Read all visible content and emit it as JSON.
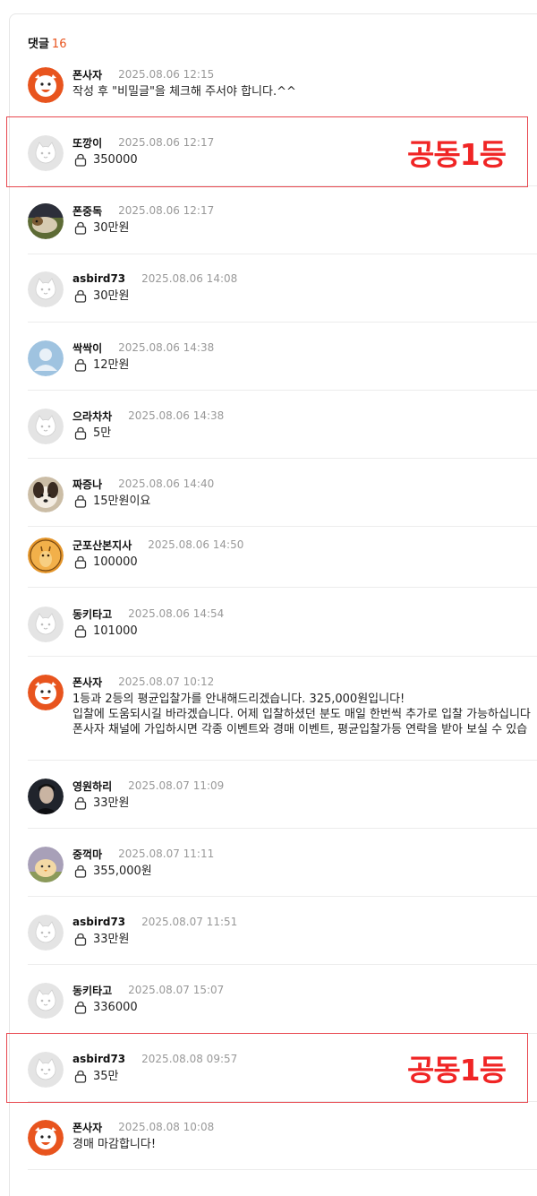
{
  "header": {
    "label": "댓글",
    "count": "16"
  },
  "badge_text": "공동1등",
  "colors": {
    "accent": "#e8541e",
    "badge": "#f02525",
    "highlight_border": "#e8474f"
  },
  "comments": [
    {
      "author": "폰사자",
      "date": "2025.08.06 12:15",
      "avatar": "lion",
      "secret": false,
      "lines": [
        "작성 후 \"비밀글\"을  체크해 주서야 합니다.^^"
      ]
    },
    {
      "author": "또깡이",
      "date": "2025.08.06 12:17",
      "avatar": "default",
      "secret": true,
      "lines": [
        "350000"
      ]
    },
    {
      "author": "폰중독",
      "date": "2025.08.06 12:17",
      "avatar": "guinea-pig",
      "secret": true,
      "lines": [
        "30만원"
      ]
    },
    {
      "author": "asbird73",
      "date": "2025.08.06 14:08",
      "avatar": "default",
      "secret": true,
      "lines": [
        "30만원"
      ]
    },
    {
      "author": "싹싹이",
      "date": "2025.08.06 14:38",
      "avatar": "person",
      "secret": true,
      "lines": [
        "12만원"
      ]
    },
    {
      "author": "으라차차",
      "date": "2025.08.06 14:38",
      "avatar": "default",
      "secret": true,
      "lines": [
        "5만"
      ]
    },
    {
      "author": "짜증나",
      "date": "2025.08.06 14:40",
      "avatar": "dog",
      "secret": true,
      "lines": [
        "15만원이요"
      ]
    },
    {
      "author": "군포산본지사",
      "date": "2025.08.06 14:50",
      "avatar": "giraffe",
      "secret": true,
      "lines": [
        "100000"
      ]
    },
    {
      "author": "동키타고",
      "date": "2025.08.06 14:54",
      "avatar": "default",
      "secret": true,
      "lines": [
        "101000"
      ]
    },
    {
      "author": "폰사자",
      "date": "2025.08.07 10:12",
      "avatar": "lion",
      "secret": false,
      "lines": [
        "1등과 2등의 평균입찰가를 안내해드리겠습니다. 325,000원입니다!",
        "입찰에 도움되시길 바라겠습니다. 어제 입찰하셨던 분도 매일 한번씩 추가로 입찰 가능하십니다",
        "폰사자 채널에 가입하시면  각종 이벤트와 경매 이벤트, 평균입찰가등  연락을 받아 보실 수 있습"
      ]
    },
    {
      "author": "영원하리",
      "date": "2025.08.07 11:09",
      "avatar": "photo-person",
      "secret": true,
      "lines": [
        "33만원"
      ]
    },
    {
      "author": "중꺽마",
      "date": "2025.08.07 11:11",
      "avatar": "chick",
      "secret": true,
      "lines": [
        "355,000원"
      ]
    },
    {
      "author": "asbird73",
      "date": "2025.08.07 11:51",
      "avatar": "default",
      "secret": true,
      "lines": [
        "33만원"
      ]
    },
    {
      "author": "동키타고",
      "date": "2025.08.07 15:07",
      "avatar": "default",
      "secret": true,
      "lines": [
        "336000"
      ]
    },
    {
      "author": "asbird73",
      "date": "2025.08.08 09:57",
      "avatar": "default",
      "secret": true,
      "lines": [
        "35만"
      ]
    },
    {
      "author": "폰사자",
      "date": "2025.08.08 10:08",
      "avatar": "lion",
      "secret": false,
      "lines": [
        "경매 마감합니다!"
      ]
    }
  ]
}
